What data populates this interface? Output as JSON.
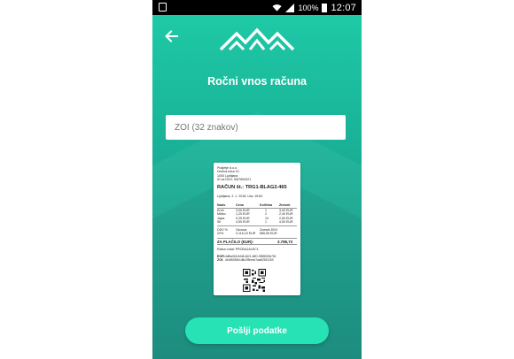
{
  "status_bar": {
    "battery_pct": "100%",
    "time": "12:07"
  },
  "header": {
    "back_icon": "arrow-left-icon",
    "logo_icon": "mountains-logo-icon"
  },
  "title": "Ročni vnos računa",
  "zoi_input": {
    "value": "",
    "placeholder": "ZOI (32 znakov)"
  },
  "receipt": {
    "company": "Podjetje d.o.o.",
    "street": "Devina ulica 10",
    "city": "1000 Ljubljana",
    "tax_id": "ID za DDV: SI87654321",
    "invoice_label": "RAČUN št.: TRG1-BLAG2-465",
    "place_date": "Ljubljana, 2. 1. 2018, Ura: 15:63",
    "col_headers": [
      "Naziv",
      "Cena",
      "Količina",
      "Znesek"
    ],
    "items": [
      [
        "Kruh",
        "3,00 EUR",
        "1",
        "3,00 EUR"
      ],
      [
        "Mleko",
        "1,20 EUR",
        "2",
        "2,40 EUR"
      ],
      [
        "Jajca",
        "0,25 EUR",
        "10",
        "2,50 EUR"
      ],
      [
        "Sir",
        "4,50 EUR",
        "1",
        "4,50 EUR"
      ]
    ],
    "vat_headers": [
      "DDV %",
      "Osnova",
      "Znesek DDV"
    ],
    "vat_row": [
      "22%",
      "3.116,15 EUR",
      "685,55 EUR"
    ],
    "total_label": "ZA PLAČILO (EUR):",
    "total_value": "3.798,73",
    "issuer": "Račun izdal: PRODAJALEC1",
    "eor_label": "EOR:",
    "eor_value": "4df6a018-8448-4621-b8f1-9598000b762",
    "zoi_label": "ZOI:",
    "zoi_value": "d1e86026b1d8c2f3bebc7aa4f2813150",
    "qr_icon": "qr-code-icon"
  },
  "send_button": {
    "label": "Pošlji podatke"
  }
}
